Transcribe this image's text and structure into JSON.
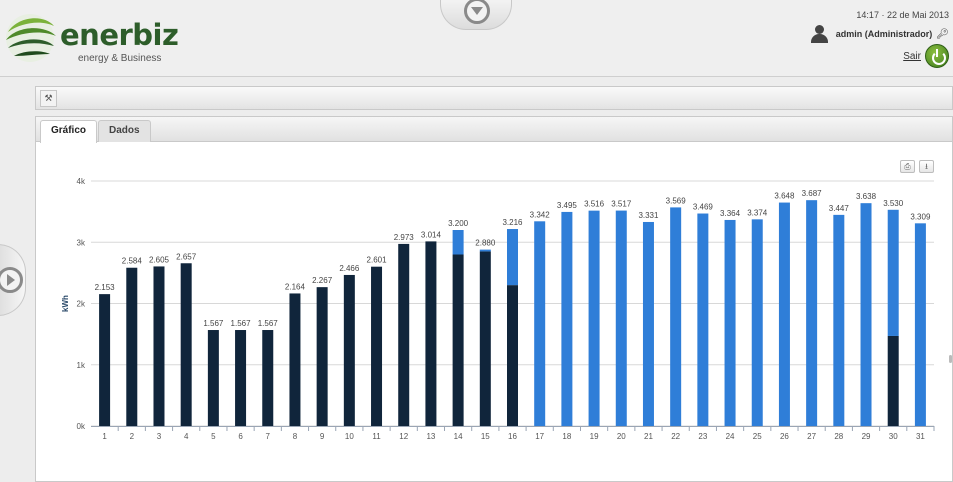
{
  "brand": {
    "name": "enerbiz",
    "tagline": "energy & Business",
    "colors": {
      "green_dark": "#2d5d2a",
      "green_light": "#7bb23a"
    }
  },
  "header": {
    "datetime": "14:17 · 22 de Mai 2013",
    "user": "admin (Administrador)",
    "logout_label": "Sair"
  },
  "tabs": [
    {
      "label": "Gráfico",
      "active": true
    },
    {
      "label": "Dados",
      "active": false
    }
  ],
  "icons": {
    "toolbar_tool": "wrench-icon",
    "print": "print-icon",
    "download": "download-icon"
  },
  "chart_data": {
    "type": "bar",
    "ylabel": "kWh",
    "ylim": [
      0,
      4000
    ],
    "yticks": [
      "0k",
      "1k",
      "2k",
      "3k",
      "4k"
    ],
    "grid": true,
    "colors": {
      "measured": "#10253b",
      "estimated": "#2f7ed8"
    },
    "categories": [
      "1",
      "2",
      "3",
      "4",
      "5",
      "6",
      "7",
      "8",
      "9",
      "10",
      "11",
      "12",
      "13",
      "14",
      "15",
      "16",
      "17",
      "18",
      "19",
      "20",
      "21",
      "22",
      "23",
      "24",
      "25",
      "26",
      "27",
      "28",
      "29",
      "30",
      "31"
    ],
    "series": [
      {
        "values": [
          2153,
          2584,
          2605,
          2657,
          1567,
          1567,
          1567,
          2164,
          2267,
          2466,
          2601,
          2973,
          3014,
          2800,
          2850,
          2300,
          0,
          0,
          0,
          0,
          0,
          0,
          0,
          0,
          0,
          0,
          0,
          0,
          0,
          1470,
          0
        ]
      },
      {
        "values": [
          0,
          0,
          0,
          0,
          0,
          0,
          0,
          0,
          0,
          0,
          0,
          0,
          0,
          400,
          30,
          916,
          3342,
          3495,
          3516,
          3517,
          3331,
          3569,
          3469,
          3364,
          3374,
          3648,
          3687,
          3447,
          3638,
          2060,
          3309
        ]
      }
    ],
    "labels": [
      "2.153",
      "2.584",
      "2.605",
      "2.657",
      "1.567",
      "1.567",
      "1.567",
      "2.164",
      "2.267",
      "2.466",
      "2.601",
      "2.973",
      "3.014",
      "3.200",
      "2.880",
      "3.216",
      "3.342",
      "3.495",
      "3.516",
      "3.517",
      "3.331",
      "3.569",
      "3.469",
      "3.364",
      "3.374",
      "3.648",
      "3.687",
      "3.447",
      "3.638",
      "3.530",
      "3.309"
    ]
  }
}
